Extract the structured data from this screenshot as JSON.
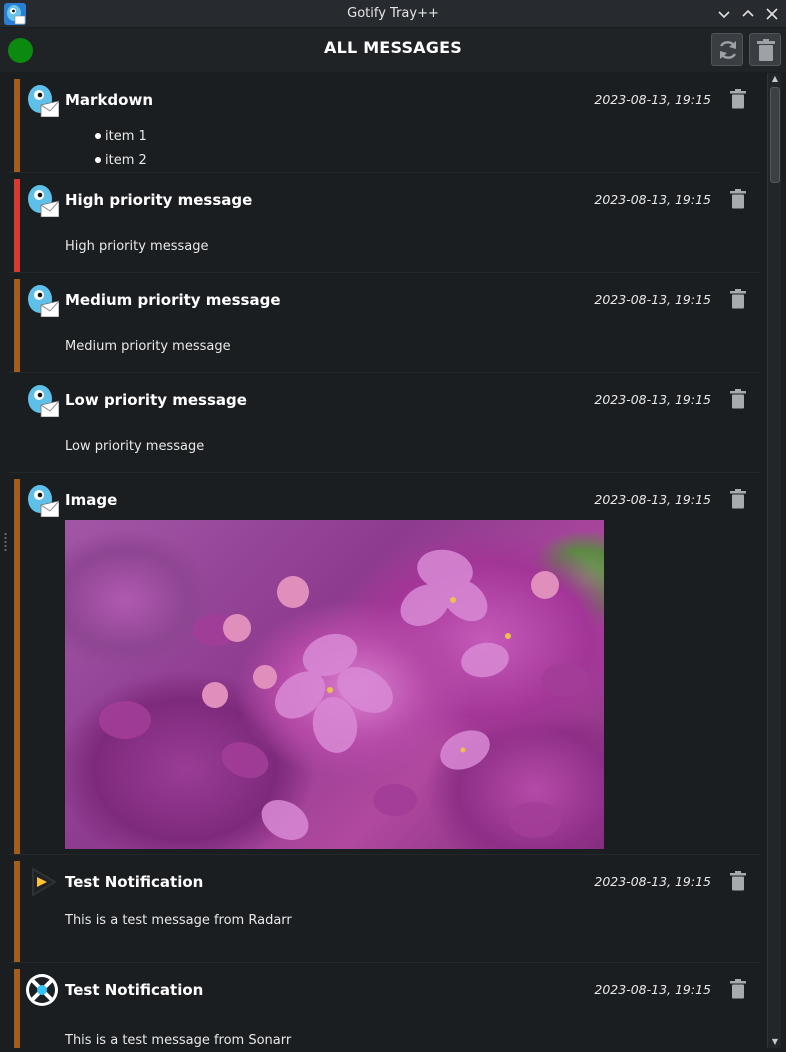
{
  "window": {
    "title": "Gotify Tray++",
    "controls": [
      "minimize",
      "maximize",
      "close"
    ]
  },
  "toolbar": {
    "title": "ALL MESSAGES",
    "status_color": "#0c8a10",
    "refresh_icon": "refresh-icon",
    "delete_all_icon": "trash-icon"
  },
  "messages": [
    {
      "title": "Markdown",
      "date": "2023-08-13, 19:15",
      "priority_color": "#a35d1c",
      "list_items": [
        "item 1",
        "item 2"
      ],
      "avatar": "gotify-gopher-icon"
    },
    {
      "title": "High priority message",
      "date": "2023-08-13, 19:15",
      "priority_color": "#d63a31",
      "body": "High priority message",
      "avatar": "gotify-gopher-icon"
    },
    {
      "title": "Medium priority message",
      "date": "2023-08-13, 19:15",
      "priority_color": "#a35d1c",
      "body": "Medium priority message",
      "avatar": "gotify-gopher-icon"
    },
    {
      "title": "Low priority message",
      "date": "2023-08-13, 19:15",
      "priority_color": "",
      "body": "Low priority message",
      "avatar": "gotify-gopher-icon"
    },
    {
      "title": "Image",
      "date": "2023-08-13, 19:15",
      "priority_color": "#a35d1c",
      "image": "lilac-flowers-photo",
      "avatar": "gotify-gopher-icon"
    },
    {
      "title": "Test Notification",
      "date": "2023-08-13, 19:15",
      "priority_color": "#a35d1c",
      "body": "This is a test message from Radarr",
      "avatar": "radarr-icon"
    },
    {
      "title": "Test Notification",
      "date": "2023-08-13, 19:15",
      "priority_color": "#a35d1c",
      "body": "This is a test message from Sonarr",
      "avatar": "sonarr-icon"
    }
  ]
}
